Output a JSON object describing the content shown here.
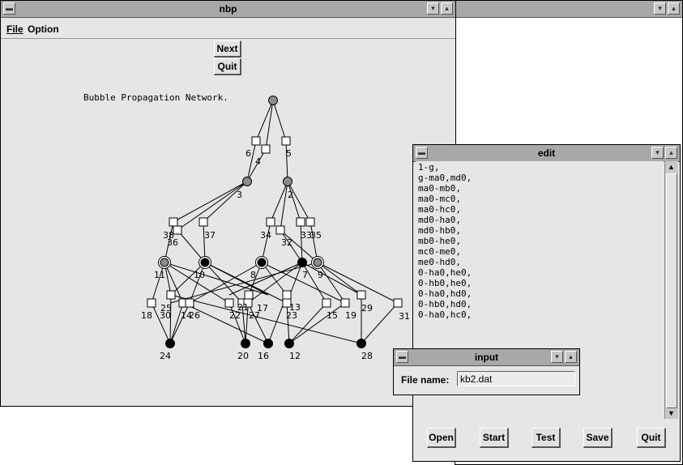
{
  "nbp": {
    "title": "nbp",
    "menu": [
      "File",
      "Option"
    ],
    "next_label": "Next",
    "quit_label": "Quit",
    "caption": "Bubble Propagation Network."
  },
  "graph": {
    "labels": [
      "6",
      "4",
      "5",
      "3",
      "2",
      "38",
      "36",
      "37",
      "34",
      "32",
      "33",
      "35",
      "11",
      "10",
      "8",
      "7",
      "9",
      "18",
      "30",
      "14",
      "26",
      "25",
      "22",
      "21",
      "27",
      "17",
      "23",
      "13",
      "15",
      "19",
      "29",
      "31",
      "24",
      "20",
      "16",
      "12",
      "28"
    ]
  },
  "edit": {
    "title": "edit",
    "lines": [
      "1-g,",
      "g-ma0,md0,",
      "ma0-mb0,",
      "ma0-mc0,",
      "ma0-hc0,",
      "md0-ha0,",
      "md0-hb0,",
      "mb0-he0,",
      "mc0-me0,",
      "me0-hd0,",
      "0-ha0,he0,",
      "0-hb0,he0,",
      "0-ha0,hd0,",
      "0-hb0,hd0,",
      "0-ha0,hc0,"
    ],
    "buttons": [
      "Open",
      "Start",
      "Test",
      "Save",
      "Quit"
    ]
  },
  "input": {
    "title": "input",
    "label": "File name:",
    "value": "kb2.dat"
  }
}
